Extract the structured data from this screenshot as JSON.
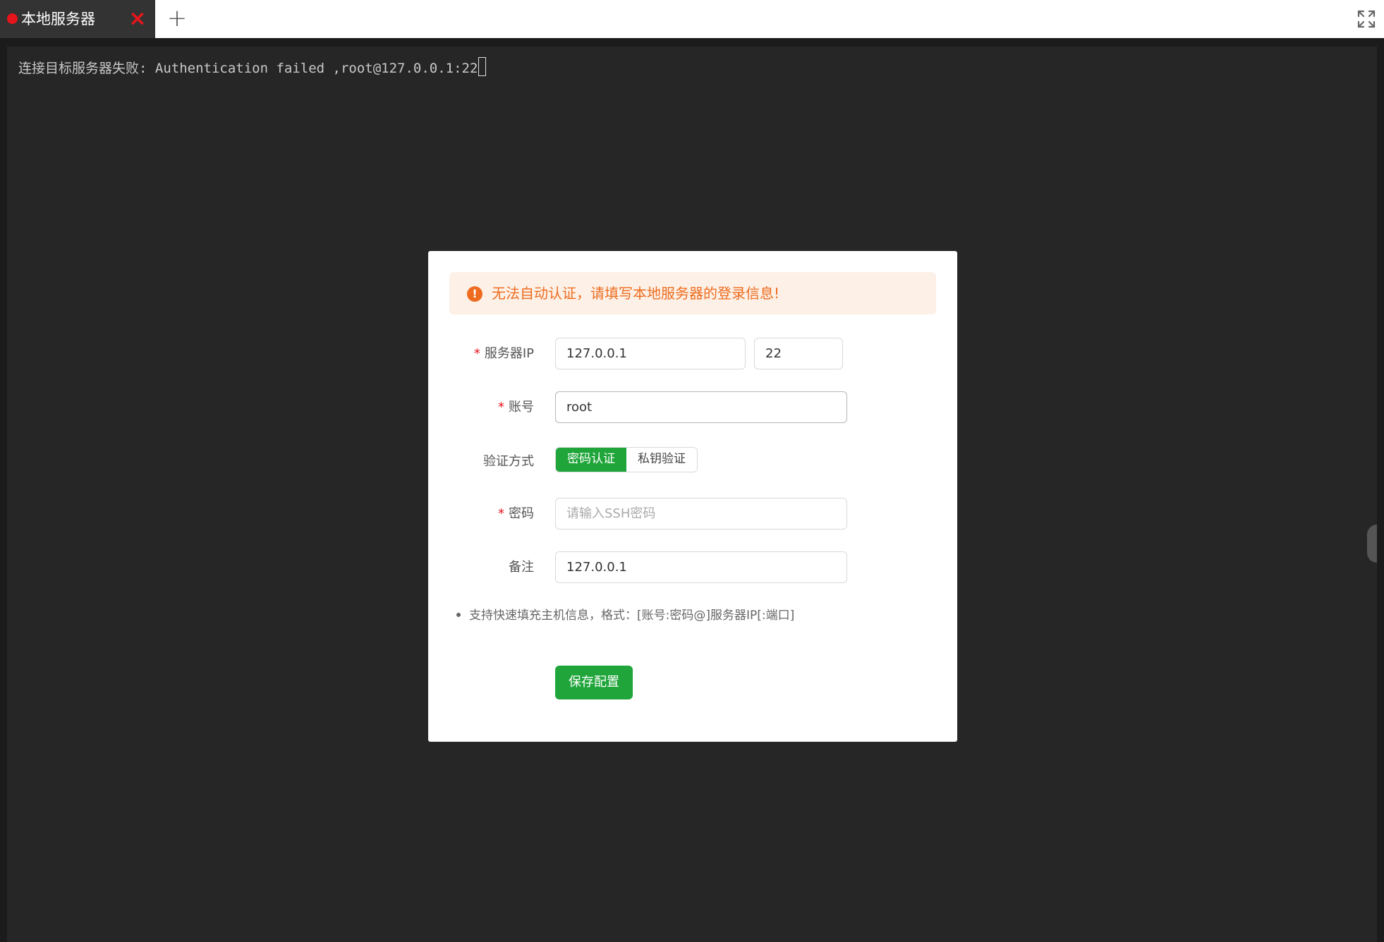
{
  "tabs": {
    "active_title": "本地服务器",
    "close_icon": "×",
    "add_icon": "+"
  },
  "terminal": {
    "message": "连接目标服务器失败: Authentication failed ,root@127.0.0.1:22"
  },
  "dialog": {
    "alert": {
      "icon": "!",
      "text": "无法自动认证，请填写本地服务器的登录信息!"
    },
    "server_ip": {
      "label": "服务器IP",
      "required_mark": "*",
      "ip_value": "127.0.0.1",
      "port_value": "22"
    },
    "account": {
      "label": "账号",
      "required_mark": "*",
      "value": "root"
    },
    "auth_method": {
      "label": "验证方式",
      "options": [
        "密码认证",
        "私钥验证"
      ],
      "selected": "密码认证"
    },
    "password": {
      "label": "密码",
      "required_mark": "*",
      "placeholder": "请输入SSH密码",
      "value": ""
    },
    "remark": {
      "label": "备注",
      "value": "127.0.0.1"
    },
    "hint": "支持快速填充主机信息，格式：[账号:密码@]服务器IP[:端口]",
    "save_label": "保存配置"
  },
  "colors": {
    "accent_green": "#20a53a",
    "alert_orange": "#ed6c1f",
    "alert_bg": "#fdf0e6",
    "status_red": "#e8141b"
  }
}
